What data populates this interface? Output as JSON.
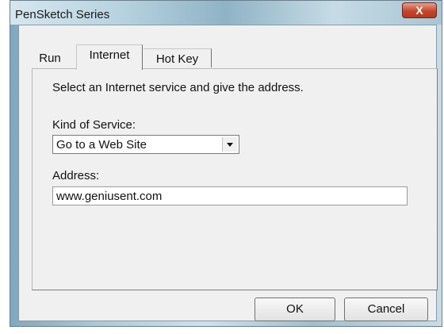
{
  "window": {
    "title": "PenSketch Series",
    "close_glyph": "X"
  },
  "tabs": [
    {
      "label": "Run",
      "active": false
    },
    {
      "label": "Internet",
      "active": true
    },
    {
      "label": "Hot Key",
      "active": false
    }
  ],
  "internet_tab": {
    "instructions": "Select an Internet service and give the address.",
    "service_label": "Kind of Service:",
    "service_value": "Go to a Web Site",
    "address_label": "Address:",
    "address_value": "www.geniusent.com"
  },
  "buttons": {
    "ok": "OK",
    "cancel": "Cancel"
  },
  "icons": {
    "close": "close-icon",
    "dropdown": "chevron-down-icon"
  }
}
